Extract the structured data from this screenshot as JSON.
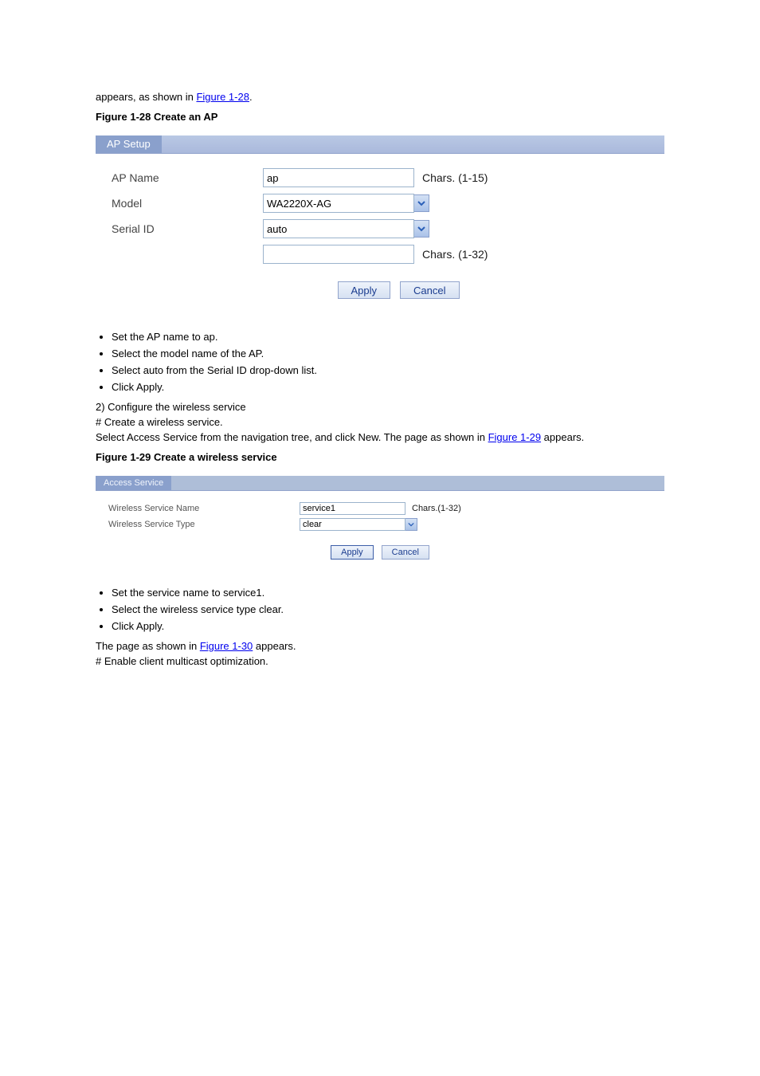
{
  "intro": {
    "line_b": "appears, as shown in ",
    "link_fig28": "Figure 1-28",
    "link_period": "."
  },
  "fig28": {
    "title": "Figure 1-28 Create an AP",
    "tab": "AP Setup",
    "labels": {
      "ap_name": "AP Name",
      "model": "Model",
      "serial_id": "Serial ID"
    },
    "values": {
      "ap_name": "ap",
      "model": "WA2220X-AG",
      "serial_id": "auto",
      "serial_extra": ""
    },
    "hints": {
      "ap_name": "Chars. (1-15)",
      "serial_extra": "Chars. (1-32)"
    },
    "buttons": {
      "apply": "Apply",
      "cancel": "Cancel"
    }
  },
  "bullets_fig28": [
    "Set the AP name to ap.",
    "Select the model name of the AP.",
    "Select auto from the Serial ID drop-down list.",
    "Click Apply."
  ],
  "step2": {
    "heading": "2) Configure the wireless service",
    "step_no": "# Create a wireless service.",
    "line_a": "Select Access Service from the navigation tree, and click New. The page as shown in ",
    "link_fig29": "Figure 1-29",
    "line_b": " appears."
  },
  "fig29": {
    "title": "Figure 1-29 Create a wireless service",
    "tab": "Access Service",
    "labels": {
      "wsname": "Wireless Service Name",
      "wstype": "Wireless Service Type"
    },
    "values": {
      "wsname": "service1",
      "wstype": "clear"
    },
    "hints": {
      "wsname": "Chars.(1-32)"
    },
    "buttons": {
      "apply": "Apply",
      "cancel": "Cancel"
    }
  },
  "bullets_fig29": [
    "Set the service name to service1.",
    "Select the wireless service type clear.",
    "Click Apply."
  ],
  "step3": {
    "line_a": "The page as shown in ",
    "link_fig30": "Figure 1-30",
    "line_b": " appears.",
    "hash": "# Enable client multicast optimization."
  }
}
